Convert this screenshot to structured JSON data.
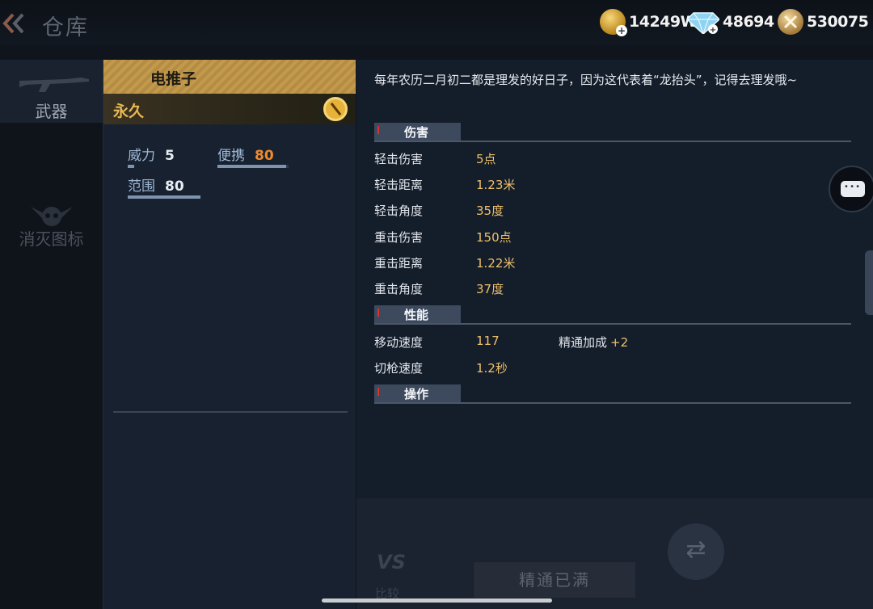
{
  "header": {
    "title": "仓库",
    "currencies": [
      {
        "icon": "gold-coin-icon",
        "value": "14249W"
      },
      {
        "icon": "diamond-icon",
        "value": "48694"
      },
      {
        "icon": "crossed-swords-coin-icon",
        "value": "530075"
      }
    ]
  },
  "sidebar": {
    "items": [
      {
        "label": "武器",
        "active": true
      },
      {
        "label": "消灭图标",
        "active": false
      }
    ]
  },
  "weapon": {
    "name": "电推子",
    "duration": "永久",
    "stats": [
      {
        "label": "威力",
        "value": "5",
        "level": 0.05
      },
      {
        "label": "便携",
        "value": "80",
        "level": 0.8
      },
      {
        "label": "范围",
        "value": "80",
        "level": 0.8
      }
    ]
  },
  "detail": {
    "description": "每年农历二月初二都是理发的好日子，因为这代表着“龙抬头”，记得去理发哦~",
    "sections": [
      {
        "title": "伤害",
        "rows": [
          {
            "key": "轻击伤害",
            "value": "5点"
          },
          {
            "key": "轻击距离",
            "value": "1.23米"
          },
          {
            "key": "轻击角度",
            "value": "35度"
          },
          {
            "key": "重击伤害",
            "value": "150点"
          },
          {
            "key": "重击距离",
            "value": "1.22米"
          },
          {
            "key": "重击角度",
            "value": "37度"
          }
        ]
      },
      {
        "title": "性能",
        "rows": [
          {
            "key": "移动速度",
            "value": "117",
            "extra_label": "精通加成",
            "extra_value": "+2"
          },
          {
            "key": "切枪速度",
            "value": "1.2秒"
          }
        ]
      },
      {
        "title": "操作",
        "rows": []
      }
    ]
  },
  "bottom": {
    "compare_vs": "VS",
    "compare_label": "比较",
    "mastery_label": "精通已满",
    "swap_icon": "swap-arrows-icon"
  },
  "colors": {
    "accent_gold": "#eec06a",
    "header_gold": "#c29a4e",
    "orange_value": "#f08a2a"
  }
}
